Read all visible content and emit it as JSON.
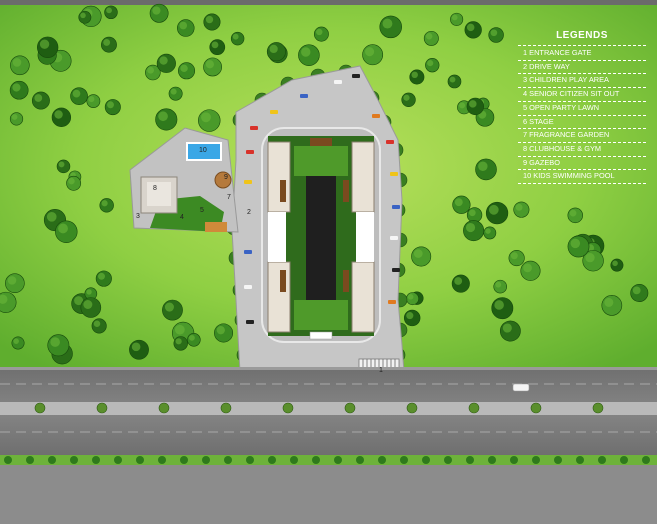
{
  "legend": {
    "title": "LEGENDS",
    "items": [
      "1  ENTRANCE GATE",
      "2 DRIVE WAY",
      "3 CHILDREN PLAY AREA",
      "4 SENIOR CITIZEN SIT OUT",
      "5 OPEN PARTY LAWN",
      "6 STAGE",
      "7 FRAGRANCE GARDEN",
      "8 CLUBHOUSE & GYM",
      "9 GAZEBO",
      "10 KIDS SWIMMING POOL"
    ]
  },
  "markers": {
    "m1": "1",
    "m2": "2",
    "m3": "3",
    "m4": "4",
    "m5": "5",
    "m7": "7",
    "m8": "8",
    "m9": "9",
    "m10": "10"
  },
  "colors": {
    "grass": "#7cc53a",
    "grass_light": "#b6e05a",
    "paving": "#c4c4c4",
    "road": "#7d7d7d",
    "lawn": "#3f8a22",
    "tree": "#2f7a1c",
    "water": "#3aa7e6",
    "text": "#ffffff"
  }
}
